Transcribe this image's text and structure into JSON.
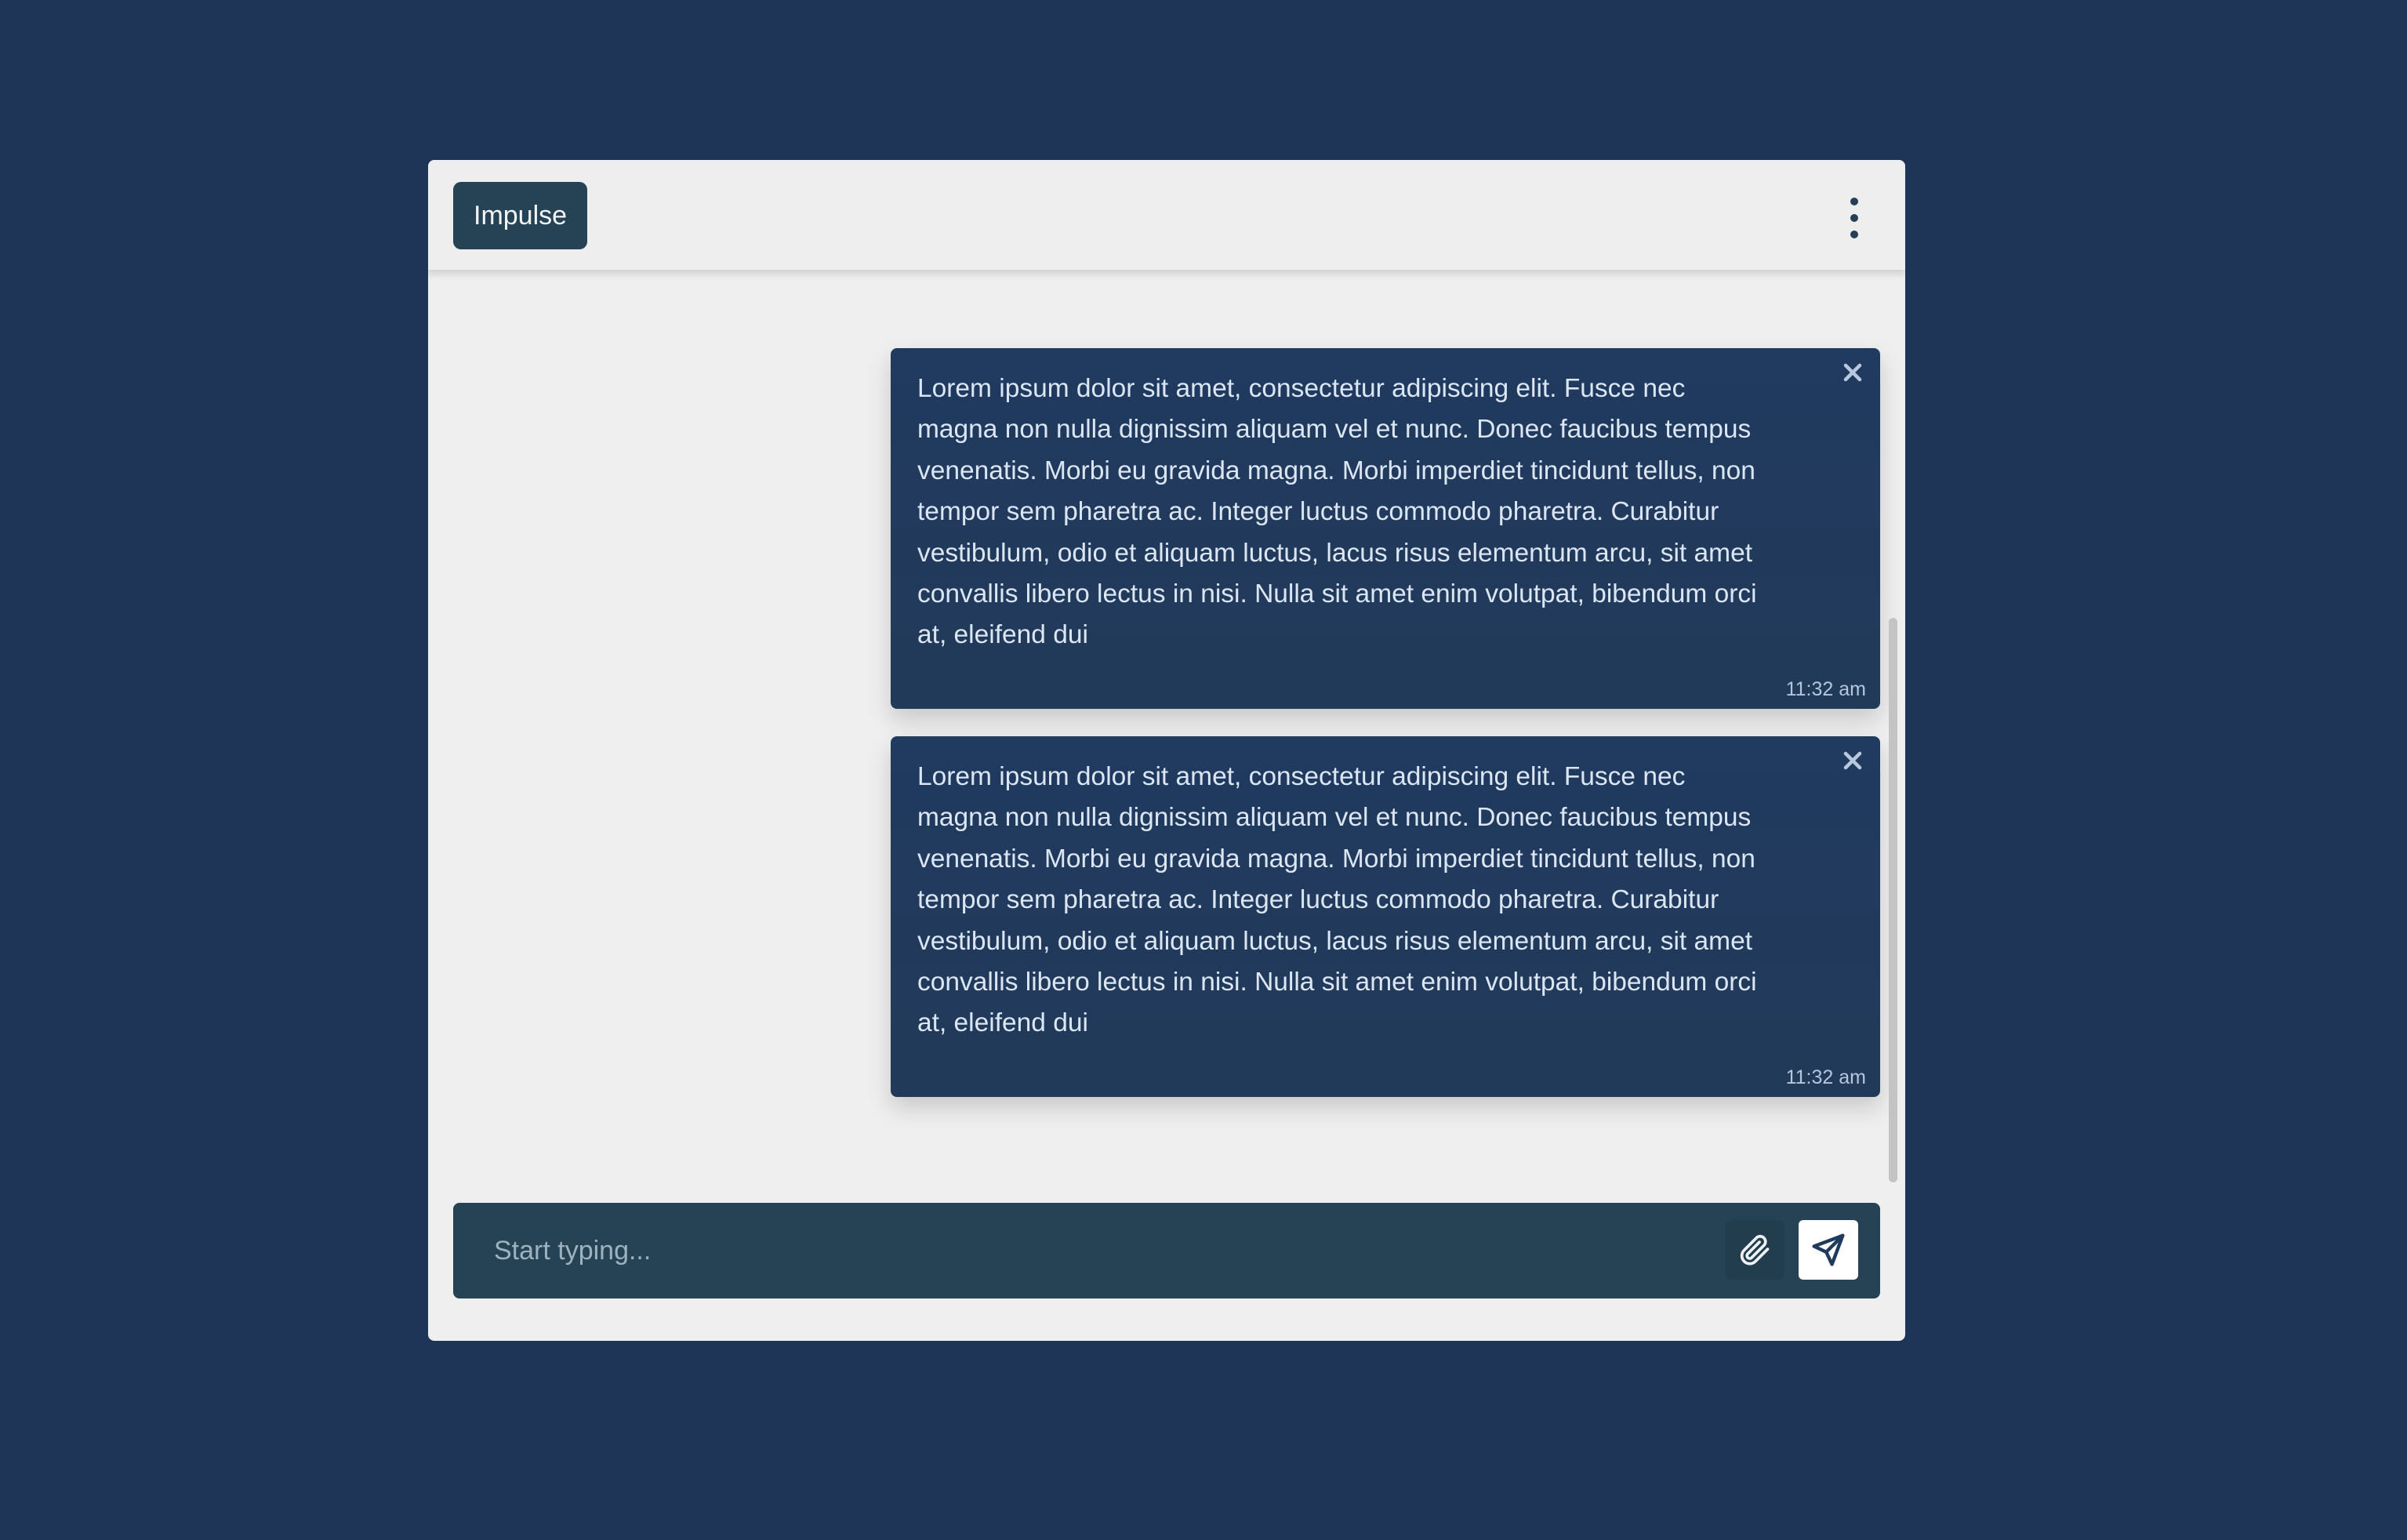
{
  "colors": {
    "page_background": "#1e3557",
    "panel_background": "#efefef",
    "accent": "#264356",
    "message_background": "#223a59"
  },
  "header": {
    "brand_label": "Impulse",
    "menu_icon": "kebab-menu-icon"
  },
  "messages": [
    {
      "text": "Lorem ipsum dolor sit amet, consectetur adipiscing elit. Fusce nec magna non nulla dignissim aliquam vel et nunc. Donec faucibus tempus venenatis. Morbi eu gravida magna. Morbi imperdiet tincidunt tellus, non tempor sem pharetra ac. Integer luctus commodo pharetra. Curabitur vestibulum, odio et aliquam luctus, lacus risus elementum arcu, sit amet convallis libero lectus in nisi. Nulla sit amet enim volutpat, bibendum orci at, eleifend dui",
      "time": "11:32 am",
      "close_icon": "close-icon"
    },
    {
      "text": "Lorem ipsum dolor sit amet, consectetur adipiscing elit. Fusce nec magna non nulla dignissim aliquam vel et nunc. Donec faucibus tempus venenatis. Morbi eu gravida magna. Morbi imperdiet tincidunt tellus, non tempor sem pharetra ac. Integer luctus commodo pharetra. Curabitur vestibulum, odio et aliquam luctus, lacus risus elementum arcu, sit amet convallis libero lectus in nisi. Nulla sit amet enim volutpat, bibendum orci at, eleifend dui",
      "time": "11:32 am",
      "close_icon": "close-icon"
    }
  ],
  "composer": {
    "value": "",
    "placeholder": "Start typing...",
    "attach_icon": "paperclip-icon",
    "send_icon": "send-icon"
  }
}
